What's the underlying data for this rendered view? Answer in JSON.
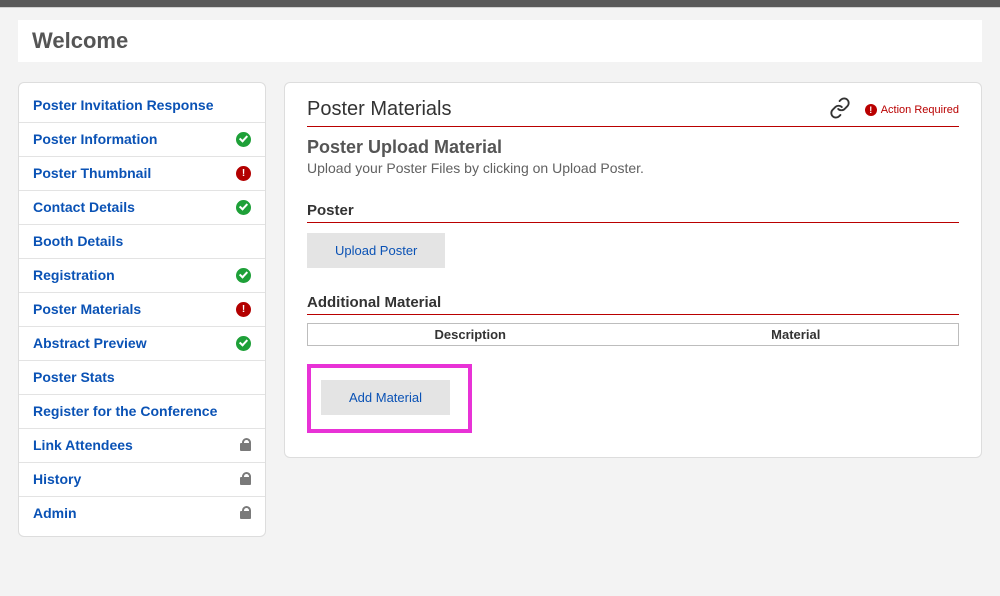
{
  "welcome": "Welcome",
  "sidebar": {
    "items": [
      {
        "label": "Poster Invitation Response",
        "status": ""
      },
      {
        "label": "Poster Information",
        "status": "ok"
      },
      {
        "label": "Poster Thumbnail",
        "status": "err"
      },
      {
        "label": "Contact Details",
        "status": "ok"
      },
      {
        "label": "Booth Details",
        "status": ""
      },
      {
        "label": "Registration",
        "status": "ok"
      },
      {
        "label": "Poster Materials",
        "status": "err"
      },
      {
        "label": "Abstract Preview",
        "status": "ok"
      },
      {
        "label": "Poster Stats",
        "status": ""
      },
      {
        "label": "Register for the Conference",
        "status": ""
      },
      {
        "label": "Link Attendees",
        "status": "lock"
      },
      {
        "label": "History",
        "status": "lock"
      },
      {
        "label": "Admin",
        "status": "lock"
      }
    ]
  },
  "main": {
    "title": "Poster Materials",
    "action_required": "Action Required",
    "upload_heading": "Poster Upload Material",
    "upload_desc": "Upload your Poster Files by clicking on Upload Poster.",
    "poster_section": "Poster",
    "upload_btn": "Upload Poster",
    "additional_section": "Additional Material",
    "table": {
      "col1": "Description",
      "col2": "Material"
    },
    "add_btn": "Add Material"
  }
}
